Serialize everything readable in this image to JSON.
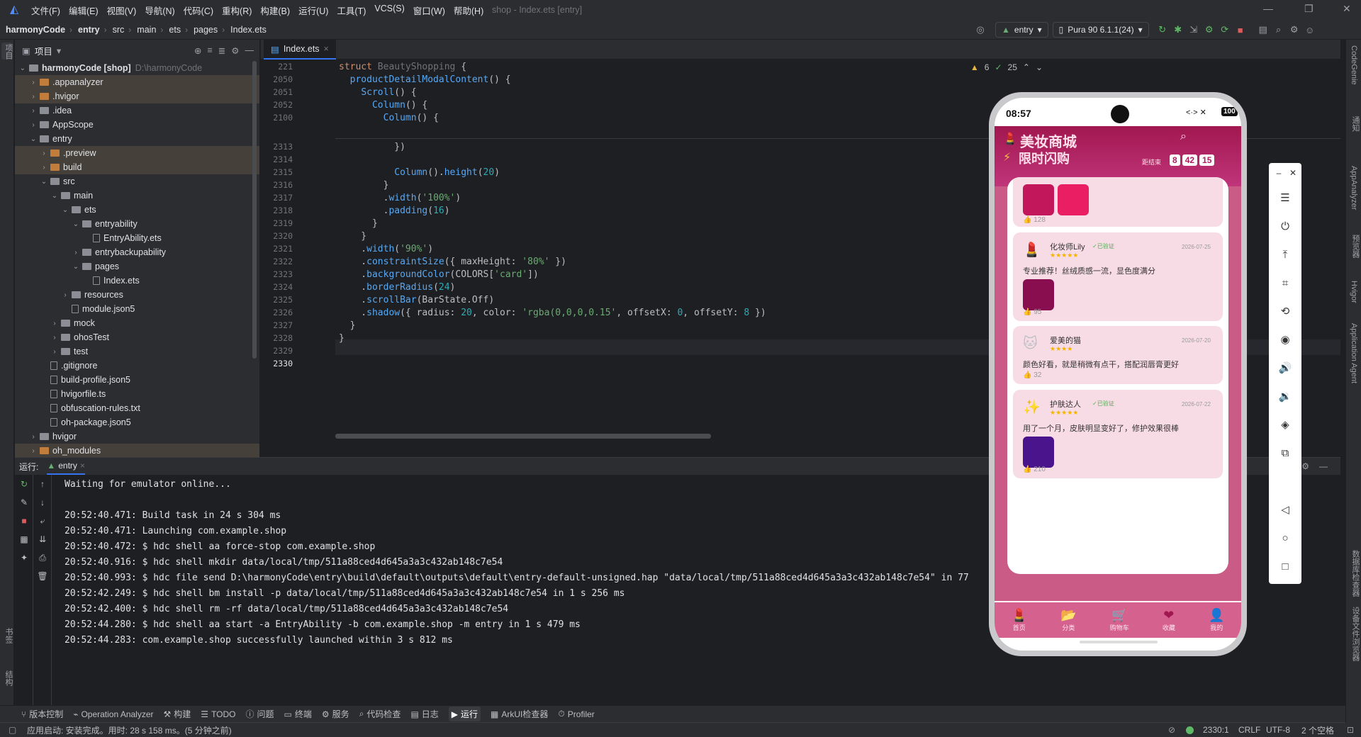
{
  "menu": {
    "items": [
      "文件(F)",
      "编辑(E)",
      "视图(V)",
      "导航(N)",
      "代码(C)",
      "重构(R)",
      "构建(B)",
      "运行(U)",
      "工具(T)",
      "VCS(S)",
      "窗口(W)",
      "帮助(H)"
    ],
    "window_title": "shop - Index.ets [entry]"
  },
  "nav": {
    "breadcrumbs": [
      "harmonyCode",
      "entry",
      "src",
      "main",
      "ets",
      "pages",
      "Index.ets"
    ],
    "module_selector": "entry",
    "device_selector": "Pura 90 6.1.1(24)"
  },
  "project": {
    "panel_title": "项目",
    "tree": [
      {
        "label": "harmonyCode [shop]",
        "extra": "D:\\harmonyCode",
        "depth": 0,
        "arrow": "v",
        "icon": "folder",
        "hl": false
      },
      {
        "label": ".appanalyzer",
        "depth": 1,
        "arrow": ">",
        "icon": "folder-o",
        "hl": true
      },
      {
        "label": ".hvigor",
        "depth": 1,
        "arrow": ">",
        "icon": "folder-o",
        "hl": true
      },
      {
        "label": ".idea",
        "depth": 1,
        "arrow": ">",
        "icon": "folder",
        "hl": false
      },
      {
        "label": "AppScope",
        "depth": 1,
        "arrow": ">",
        "icon": "folder",
        "hl": false
      },
      {
        "label": "entry",
        "depth": 1,
        "arrow": "v",
        "icon": "folder",
        "hl": false
      },
      {
        "label": ".preview",
        "depth": 2,
        "arrow": ">",
        "icon": "folder-o",
        "hl": true
      },
      {
        "label": "build",
        "depth": 2,
        "arrow": ">",
        "icon": "folder-o",
        "hl": true
      },
      {
        "label": "src",
        "depth": 2,
        "arrow": "v",
        "icon": "folder",
        "hl": false
      },
      {
        "label": "main",
        "depth": 3,
        "arrow": "v",
        "icon": "folder",
        "hl": false
      },
      {
        "label": "ets",
        "depth": 4,
        "arrow": "v",
        "icon": "folder",
        "hl": false
      },
      {
        "label": "entryability",
        "depth": 5,
        "arrow": "v",
        "icon": "folder",
        "hl": false
      },
      {
        "label": "EntryAbility.ets",
        "depth": 6,
        "arrow": "",
        "icon": "file",
        "hl": false
      },
      {
        "label": "entrybackupability",
        "depth": 5,
        "arrow": ">",
        "icon": "folder",
        "hl": false
      },
      {
        "label": "pages",
        "depth": 5,
        "arrow": "v",
        "icon": "folder",
        "hl": false
      },
      {
        "label": "Index.ets",
        "depth": 6,
        "arrow": "",
        "icon": "file",
        "hl": false
      },
      {
        "label": "resources",
        "depth": 4,
        "arrow": ">",
        "icon": "folder",
        "hl": false
      },
      {
        "label": "module.json5",
        "depth": 4,
        "arrow": "",
        "icon": "file",
        "hl": false
      },
      {
        "label": "mock",
        "depth": 3,
        "arrow": ">",
        "icon": "folder",
        "hl": false
      },
      {
        "label": "ohosTest",
        "depth": 3,
        "arrow": ">",
        "icon": "folder",
        "hl": false
      },
      {
        "label": "test",
        "depth": 3,
        "arrow": ">",
        "icon": "folder",
        "hl": false
      },
      {
        "label": ".gitignore",
        "depth": 2,
        "arrow": "",
        "icon": "file",
        "hl": false
      },
      {
        "label": "build-profile.json5",
        "depth": 2,
        "arrow": "",
        "icon": "file",
        "hl": false
      },
      {
        "label": "hvigorfile.ts",
        "depth": 2,
        "arrow": "",
        "icon": "file",
        "hl": false
      },
      {
        "label": "obfuscation-rules.txt",
        "depth": 2,
        "arrow": "",
        "icon": "file",
        "hl": false
      },
      {
        "label": "oh-package.json5",
        "depth": 2,
        "arrow": "",
        "icon": "file",
        "hl": false
      },
      {
        "label": "hvigor",
        "depth": 1,
        "arrow": ">",
        "icon": "folder",
        "hl": false
      },
      {
        "label": "oh_modules",
        "depth": 1,
        "arrow": ">",
        "icon": "folder-o",
        "hl": true
      }
    ]
  },
  "editor": {
    "tab": "Index.ets",
    "inspections": {
      "warnings": "6",
      "ok": "25"
    },
    "sticky": [
      {
        "ln": "221",
        "html": "<span class='kw'>struct</span> <span style='color:#6f737a'>BeautyShopping</span> {"
      },
      {
        "ln": "2050",
        "html": "  <span class='fn'>productDetailModalContent</span>() {"
      },
      {
        "ln": "2051",
        "html": "    <span class='fn'>Scroll</span>() {"
      },
      {
        "ln": "2052",
        "html": "      <span class='fn'>Column</span>() {"
      },
      {
        "ln": "2100",
        "html": "        <span class='fn'>Column</span>() {"
      }
    ],
    "lines": [
      {
        "ln": "2313",
        "html": "          })"
      },
      {
        "ln": "2314",
        "html": ""
      },
      {
        "ln": "2315",
        "html": "          <span class='fn'>Column</span>().<span class='fn'>height</span>(<span class='nm'>20</span>)"
      },
      {
        "ln": "2316",
        "html": "        }"
      },
      {
        "ln": "2317",
        "html": "        .<span class='fn'>width</span>(<span class='st'>'100%'</span>)"
      },
      {
        "ln": "2318",
        "html": "        .<span class='fn'>padding</span>(<span class='nm'>16</span>)"
      },
      {
        "ln": "2319",
        "html": "      }"
      },
      {
        "ln": "2320",
        "html": "    }"
      },
      {
        "ln": "2321",
        "html": "    .<span class='fn'>width</span>(<span class='st'>'90%'</span>)"
      },
      {
        "ln": "2322",
        "html": "    .<span class='fn'>constraintSize</span>({ maxHeight: <span class='st'>'80%'</span> })"
      },
      {
        "ln": "2323",
        "html": "    .<span class='fn'>backgroundColor</span>(COLORS[<span class='st'>'card'</span>])"
      },
      {
        "ln": "2324",
        "html": "    .<span class='fn'>borderRadius</span>(<span class='nm'>24</span>)"
      },
      {
        "ln": "2325",
        "html": "    .<span class='fn'>scrollBar</span>(BarState.Off)"
      },
      {
        "ln": "2326",
        "html": "    .<span class='fn'>shadow</span>({ radius: <span class='nm'>20</span>, color: <span class='st'>'rgba(0,0,0,0.15'</span>, offsetX: <span class='nm'>0</span>, offsetY: <span class='nm'>8</span> })"
      },
      {
        "ln": "2327",
        "html": "  }"
      },
      {
        "ln": "2328",
        "html": "}"
      },
      {
        "ln": "2329",
        "html": ""
      },
      {
        "ln": "2330",
        "html": ""
      }
    ]
  },
  "run": {
    "label": "运行:",
    "tab": "entry",
    "lines": [
      "Waiting for emulator online...",
      "",
      "20:52:40.471: Build task in 24 s 304 ms",
      "20:52:40.471: Launching com.example.shop",
      "20:52:40.472: $ hdc shell aa force-stop com.example.shop",
      "20:52:40.916: $ hdc shell mkdir data/local/tmp/511a88ced4d645a3a3c432ab148c7e54",
      "20:52:40.993: $ hdc file send D:\\harmonyCode\\entry\\build\\default\\outputs\\default\\entry-default-unsigned.hap \"data/local/tmp/511a88ced4d645a3a3c432ab148c7e54\" in 77",
      "20:52:42.249: $ hdc shell bm install -p data/local/tmp/511a88ced4d645a3a3c432ab148c7e54 in 1 s 256 ms",
      "20:52:42.400: $ hdc shell rm -rf data/local/tmp/511a88ced4d645a3a3c432ab148c7e54",
      "20:52:44.280: $ hdc shell aa start -a EntryAbility -b com.example.shop -m entry in 1 s 479 ms",
      "20:52:44.283: com.example.shop successfully launched within 3 s 812 ms"
    ]
  },
  "bottom_tools": [
    "版本控制",
    "Operation Analyzer",
    "构建",
    "TODO",
    "问题",
    "终端",
    "服务",
    "代码检查",
    "日志",
    "运行",
    "ArkUI检查器",
    "Profiler"
  ],
  "status": {
    "message": "应用启动: 安装完成。用时: 28 s 158 ms。(5 分钟之前)",
    "position": "2330:1",
    "line_sep": "CRLF",
    "encoding": "UTF-8",
    "indent": "2 个空格"
  },
  "right_strip": [
    "CodeGenie",
    "通知",
    "AppAnalyzer",
    "预览器",
    "Hvigor",
    "Application Agent",
    "数据库检查器",
    "设备文件浏览器"
  ],
  "left_strip": [
    "项目",
    "书签",
    "结构"
  ],
  "phone": {
    "time": "08:57",
    "battery": "100",
    "app_title": "美妆商城",
    "flash_title": "限时闪购",
    "countdown_label": "距结束",
    "countdown": [
      "8",
      "42",
      "15"
    ],
    "colors": {
      "brand": "#b01a5b",
      "card": "#f8dce5",
      "accent": "#e91e63"
    },
    "reviews_partial": {
      "likes": "128",
      "swatches": [
        "#c2185b",
        "#e91e63"
      ]
    },
    "reviews": [
      {
        "avatar": "💄",
        "name": "化妆师Lily",
        "verified": "✓已验证",
        "date": "2026-07-25",
        "stars": "★★★★★",
        "text": "专业推荐！丝绒质感一流，显色度满分",
        "swatch": "#880e4f",
        "likes": "95"
      },
      {
        "avatar": "🐱",
        "name": "爱美的猫",
        "verified": "",
        "date": "2026-07-20",
        "stars": "★★★★",
        "text": "颜色好看，就是稍微有点干，搭配润唇膏更好",
        "swatch": "",
        "likes": "32"
      },
      {
        "avatar": "✨",
        "name": "护肤达人",
        "verified": "✓已验证",
        "date": "2026-07-22",
        "stars": "★★★★★",
        "text": "用了一个月，皮肤明显变好了，修护效果很棒",
        "swatch": "#4a148c",
        "likes": "210"
      }
    ],
    "tabs": [
      {
        "icon": "💄",
        "label": "首页"
      },
      {
        "icon": "📂",
        "label": "分类"
      },
      {
        "icon": "🛒",
        "label": "购物车"
      },
      {
        "icon": "❤",
        "label": "收藏"
      },
      {
        "icon": "👤",
        "label": "我的"
      }
    ]
  }
}
